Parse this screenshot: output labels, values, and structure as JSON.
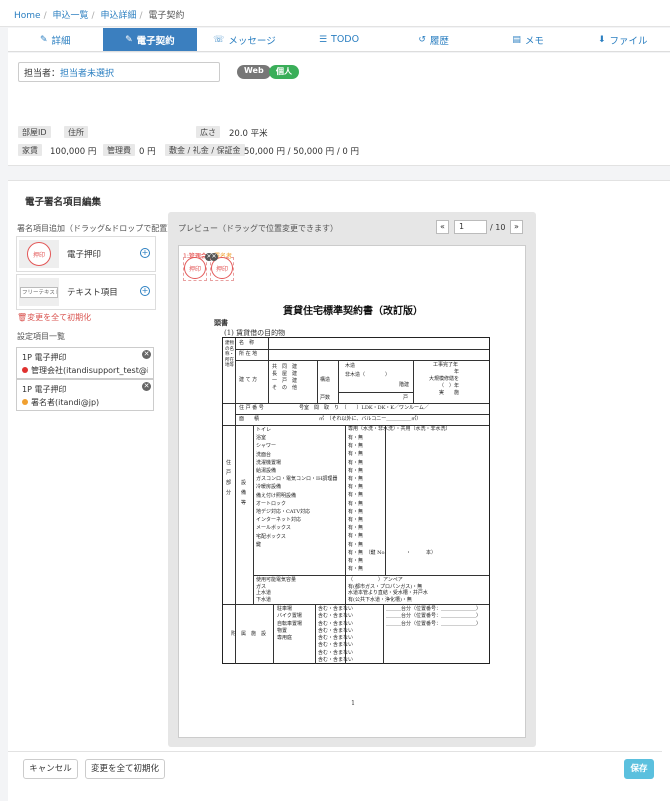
{
  "breadcrumb": {
    "home": "Home",
    "list": "申込一覧",
    "detail": "申込詳細",
    "current": "電子契約"
  },
  "tabs": [
    {
      "label": "詳細",
      "icon": "edit-icon"
    },
    {
      "label": "電子契約",
      "icon": "edit-icon"
    },
    {
      "label": "メッセージ",
      "icon": "chat-icon"
    },
    {
      "label": "TODO",
      "icon": "list-icon"
    },
    {
      "label": "履歴",
      "icon": "history-icon"
    },
    {
      "label": "メモ",
      "icon": "memo-icon"
    },
    {
      "label": "ファイル",
      "icon": "download-icon"
    }
  ],
  "assignee": {
    "label": "担当者：",
    "value": "担当者未選択"
  },
  "badges": {
    "web": "Web",
    "kojin": "個人"
  },
  "property": {
    "room_id_label": "部屋ID",
    "address_label": "住所",
    "area_label": "広さ",
    "area_value": "20.0 平米",
    "rent_label": "家賃",
    "rent_value": "100,000 円",
    "mgmt_label": "管理費",
    "mgmt_value": "0 円",
    "deposit_label": "敷金 / 礼金 / 保証金",
    "deposit_value": "50,000 円 / 50,000 円 / 0 円"
  },
  "editor": {
    "title": "電子署名項目編集",
    "add_label": "署名項目追加（ドラッグ&ドロップで配置）",
    "items": [
      {
        "name": "電子押印",
        "thumb": "押印"
      },
      {
        "name": "テキスト項目",
        "thumb": "フリーテキスト"
      }
    ],
    "reset_link": "変更を全て初期化",
    "settings_label": "設定項目一覧",
    "settings": [
      {
        "page": "1P 電子押印",
        "who": "管理会社(itandisupport_test@it…",
        "color": "#e0312f"
      },
      {
        "page": "1P 電子押印",
        "who": "署名者(itandi@jp)",
        "color": "#f0a030"
      }
    ],
    "preview_label": "プレビュー（ドラッグで位置変更できます）",
    "pager": {
      "prev": "«",
      "current": "1",
      "total": "/ 10",
      "next": "»"
    }
  },
  "document": {
    "stamp_tags": [
      "1:管理会",
      "署名者"
    ],
    "stamp_text": "押印",
    "title": "賃貸住宅標準契約書（改訂版）",
    "head": "頭書",
    "sub": "(1)  賃貸借の目的物",
    "page_number": "1",
    "rows": {
      "name": "名　称",
      "location": "所 在 地",
      "left_col": "建物の名称・所在地等",
      "build": "建 て 方",
      "types": "共　同　建\n長　屋　建\n一　戸　建\nそ　の　他",
      "structure": "構造",
      "structure_vals": "木造\n非木造（　　　　）",
      "floors": "階建",
      "units": "戸数",
      "unit_suffix": "戸",
      "completion": "工事完了年",
      "completion_vals": "年\n大規模修繕を\n（　）年\n実　　施",
      "unit_no": "住 戸 番 号",
      "layout": "号室　間　取　り　（　　）LDK・DK・K／ワンルーム／",
      "area": "面　　積",
      "area_val": "㎡　（それ以外に、バルコニー＿＿＿＿＿㎡）",
      "left_col2": "住　戸　部　分",
      "equip_label": "設　備　等",
      "equip_list": "トイレ\n浴室\nシャワー\n洗面台\n洗濯機置場\n給湯設備\nガスコンロ・電気コンロ・IH調理器\n冷暖房設備\n備え付け照明設備\nオートロック\n地デジ対応・CATV対応\nインターネット対応\nメールボックス\n宅配ボックス\n鍵",
      "equip_header": "専用（水洗・非水洗）・共用（水洗・非水洗）",
      "equip_yesno": "有・無\n有・無\n有・無\n有・無\n有・無\n有・無\n有・無\n有・無\n有・無\n有・無\n有・無\n有・無\n有・無\n有・無\n有・無　（鍵 No.　　　　・　　　本）\n有・無\n有・無",
      "utilities": "使用可能電気容量\nガス\n上水道\n下水道",
      "utilities_vals": "（　　　　　）アンペア\n有(都市ガス・プロパンガス)・無\n水道本管より直結・受水槽・井戸水\n有(公共下水道・浄化槽)・無",
      "attached": "附　属　施　設",
      "attached_list": "駐車場\nバイク置場\n自転車置場\n物置\n専用庭",
      "attached_incl": "含む・含まない\n含む・含まない\n含む・含まない\n含む・含まない\n含む・含まない\n含む・含まない\n含む・含まない\n含む・含まない",
      "attached_spaces": "＿＿＿台分（位置番号：＿＿＿＿＿＿＿）\n＿＿＿台分（位置番号：＿＿＿＿＿＿＿）\n＿＿＿台分（位置番号：＿＿＿＿＿＿＿）"
    }
  },
  "footer": {
    "cancel": "キャンセル",
    "reset": "変更を全て初期化",
    "save": "保存"
  }
}
